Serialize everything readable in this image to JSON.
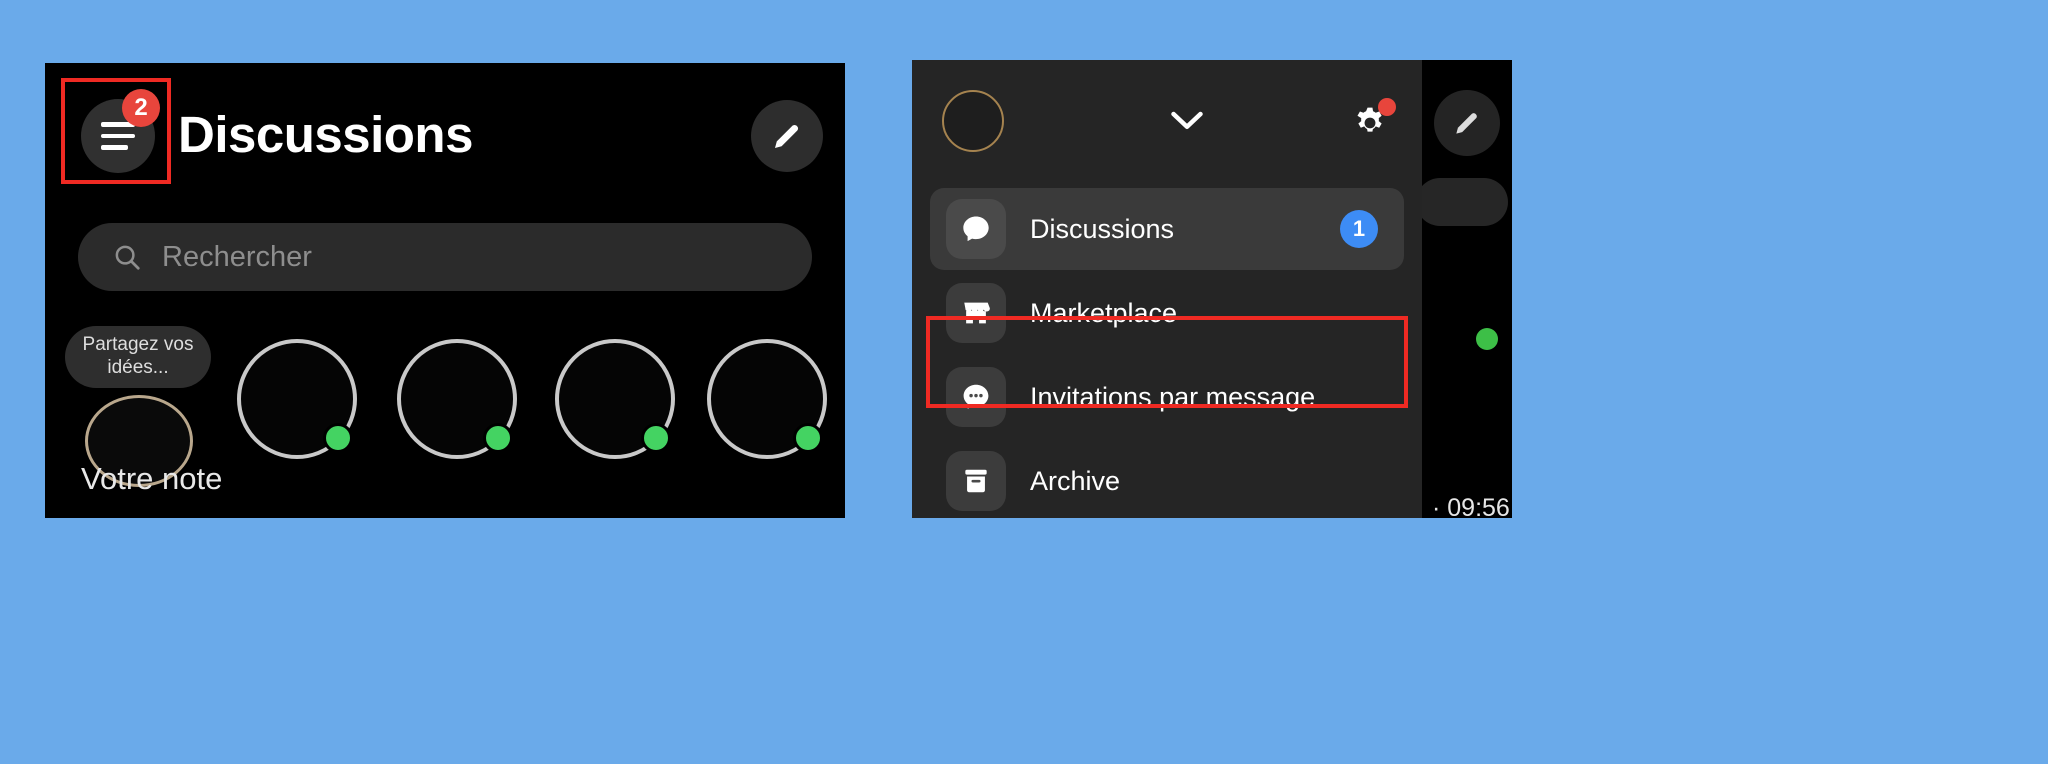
{
  "meta": {
    "background_color": "#6aaaea",
    "highlight_color": "#ef2a23"
  },
  "left_panel": {
    "name": "messenger-discussions-screen",
    "background": "#000000",
    "header": {
      "menu_button": {
        "icon": "hamburger-menu-icon",
        "badge_count": "2",
        "badge_color": "#e8453c",
        "highlighted": true
      },
      "title": "Discussions",
      "compose_button": {
        "icon": "pencil-compose-icon",
        "label": "Nouveau message"
      }
    },
    "search": {
      "icon": "search-icon",
      "placeholder": "Rechercher",
      "value": ""
    },
    "notes": {
      "note_bubble_text": "Partagez vos idées...",
      "your_note_label": "Votre note",
      "stories": [
        {
          "name": "story-1",
          "online": true
        },
        {
          "name": "story-2",
          "online": true
        },
        {
          "name": "story-3",
          "online": true
        },
        {
          "name": "story-4",
          "online": true
        }
      ]
    }
  },
  "right_panel": {
    "name": "messenger-side-drawer",
    "background": "#0a0a0a",
    "drawer_background": "#252525",
    "header": {
      "avatar": "profile-avatar",
      "chevron": "chevron-down-icon",
      "settings": {
        "icon": "gear-icon",
        "has_notification_dot": true,
        "dot_color": "#e8453c"
      }
    },
    "menu_items": [
      {
        "label": "Discussions",
        "icon": "chat-bubble-icon",
        "badge": "1",
        "badge_color": "#3d8cf5",
        "active": true,
        "highlighted": false
      },
      {
        "label": "Marketplace",
        "icon": "storefront-icon",
        "badge": "",
        "active": false,
        "highlighted": false
      },
      {
        "label": "Invitations par message",
        "icon": "chat-bubble-dots-icon",
        "badge": "",
        "active": false,
        "highlighted": true
      },
      {
        "label": "Archive",
        "icon": "archive-box-icon",
        "badge": "",
        "active": false,
        "highlighted": false
      }
    ],
    "strip": {
      "compose_icon": "pencil-compose-icon",
      "timestamp": "· 09:56",
      "online_indicator": true
    }
  }
}
